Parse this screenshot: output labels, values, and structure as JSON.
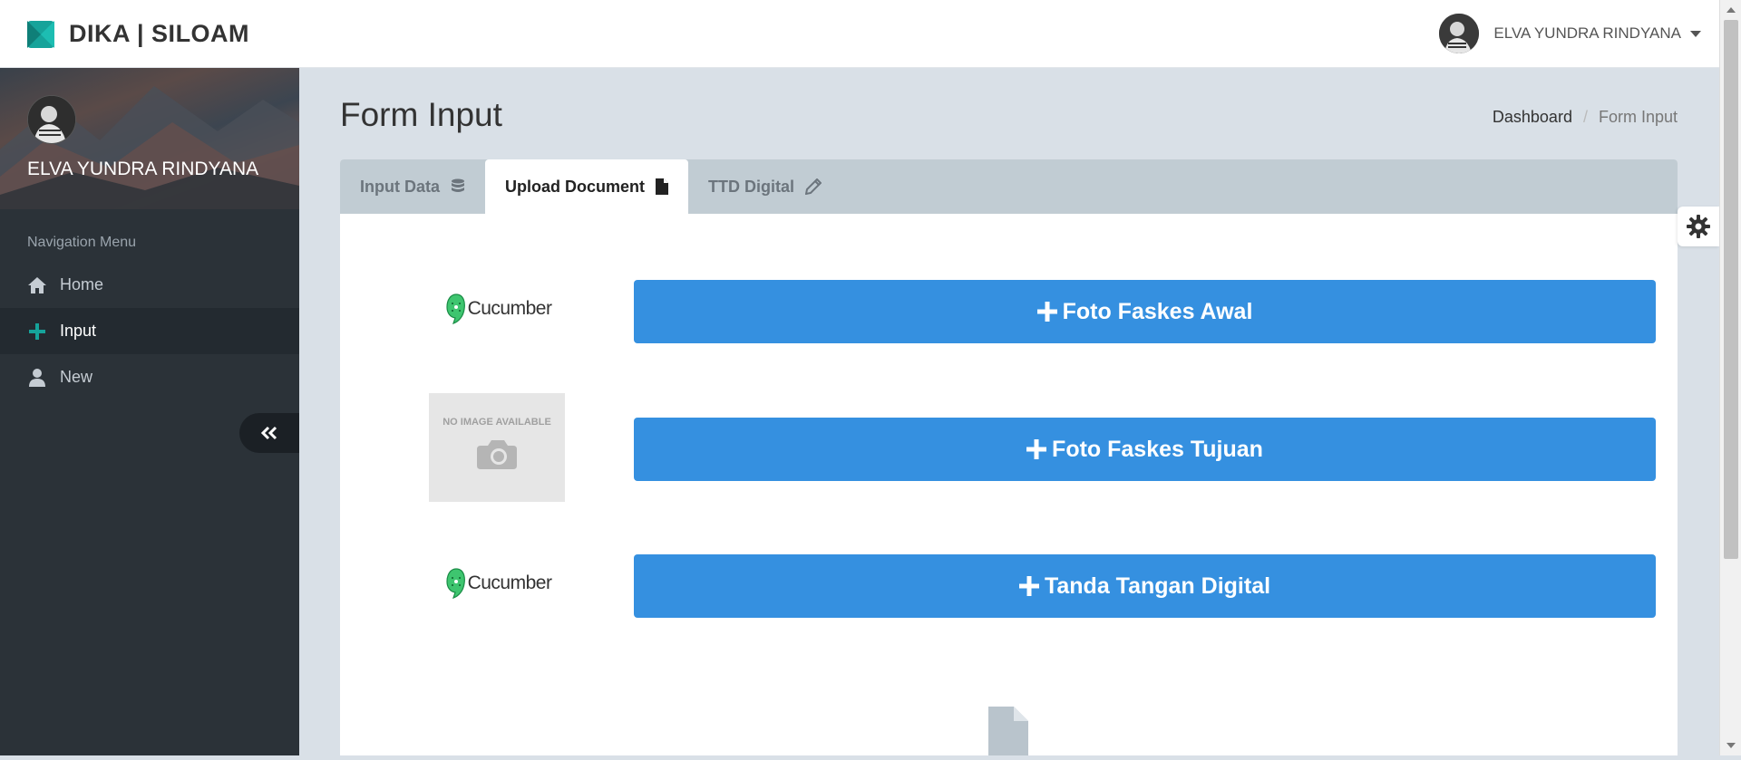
{
  "brand": {
    "name": "DIKA | SILOAM",
    "color": "#16a39a"
  },
  "header": {
    "user_name": "ELVA YUNDRA RINDYANA"
  },
  "sidebar": {
    "profile_name": "ELVA YUNDRA RINDYANA",
    "nav_header": "Navigation Menu",
    "items": [
      {
        "label": "Home",
        "icon": "home-icon",
        "active": false
      },
      {
        "label": "Input",
        "icon": "plus-icon",
        "active": true
      },
      {
        "label": "New",
        "icon": "user-icon",
        "active": false
      }
    ]
  },
  "page": {
    "title": "Form Input"
  },
  "breadcrumb": {
    "home": "Dashboard",
    "current": "Form Input"
  },
  "tabs": [
    {
      "label": "Input Data",
      "icon": "database-icon",
      "active": false
    },
    {
      "label": "Upload Document",
      "icon": "file-icon",
      "active": true
    },
    {
      "label": "TTD Digital",
      "icon": "pencil-icon",
      "active": false
    }
  ],
  "uploads": [
    {
      "thumb": "cucumber-logo",
      "thumb_text": "Cucumber",
      "button_label": "Foto Faskes Awal"
    },
    {
      "thumb": "no-image-placeholder",
      "thumb_text": "NO IMAGE AVAILABLE",
      "button_label": "Foto Faskes Tujuan"
    },
    {
      "thumb": "cucumber-logo",
      "thumb_text": "Cucumber",
      "button_label": "Tanda Tangan Digital"
    }
  ],
  "colors": {
    "primary": "#3590e0",
    "sidebar": "#2b3238",
    "accent": "#16a39a"
  }
}
